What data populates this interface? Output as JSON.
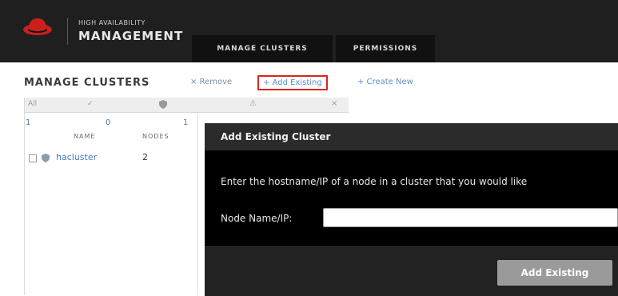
{
  "header": {
    "brand_top": "HIGH AVAILABILITY",
    "brand_main": "MANAGEMENT",
    "logo_icon": "redhat-hat-icon",
    "tabs": [
      {
        "label": "MANAGE CLUSTERS"
      },
      {
        "label": "PERMISSIONS"
      }
    ]
  },
  "toolbar": {
    "title": "MANAGE CLUSTERS",
    "remove_label": "× Remove",
    "add_existing_label": "+ Add Existing",
    "create_new_label": "+ Create New"
  },
  "cluster_list": {
    "filters": {
      "all": "All",
      "ok": "✓",
      "warning": "⚠",
      "close": "×"
    },
    "counts": {
      "all": "1",
      "ok": "0",
      "shield": "1"
    },
    "columns": {
      "name": "NAME",
      "nodes": "NODES"
    },
    "rows": [
      {
        "name": "hacluster",
        "nodes": "2"
      }
    ]
  },
  "modal": {
    "title": "Add Existing Cluster",
    "description": "Enter the hostname/IP of a node in a cluster that you would like",
    "node_label": "Node Name/IP:",
    "node_value": "",
    "submit_label": "Add Existing"
  },
  "colors": {
    "header_bg": "#1f1f1f",
    "brand_red": "#d9261c",
    "link_blue": "#5b8ec9",
    "modal_bg": "#000000"
  }
}
